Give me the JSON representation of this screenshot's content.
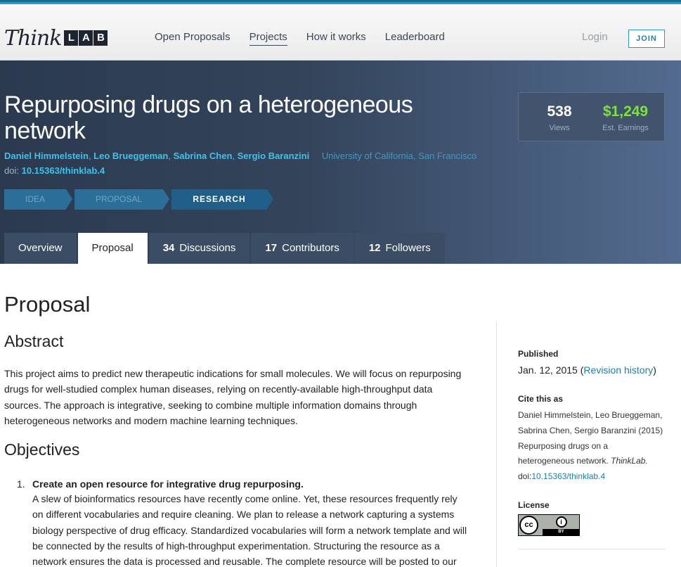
{
  "header": {
    "logo_text": "Think",
    "logo_box": [
      "L",
      "A",
      "B"
    ],
    "nav": [
      {
        "label": "Open Proposals",
        "active": false
      },
      {
        "label": "Projects",
        "active": true
      },
      {
        "label": "How it works",
        "active": false
      },
      {
        "label": "Leaderboard",
        "active": false
      }
    ],
    "login_label": "Login",
    "join_label": "JOIN"
  },
  "project": {
    "title": "Repurposing drugs on a heterogeneous network",
    "authors": [
      "Daniel Himmelstein",
      "Leo Brueggeman",
      "Sabrina Chen",
      "Sergio Baranzini"
    ],
    "affiliation": "University of California, San Francisco",
    "doi_label": "doi:",
    "doi": "10.15363/thinklab.4",
    "stages": [
      "IDEA",
      "PROPOSAL",
      "RESEARCH"
    ],
    "current_stage": "RESEARCH",
    "stats": {
      "views": "538",
      "views_label": "Views",
      "earnings": "$1,249",
      "earnings_label": "Est. Earnings"
    },
    "tabs": [
      {
        "count": "",
        "label": "Overview",
        "active": false
      },
      {
        "count": "",
        "label": "Proposal",
        "active": true
      },
      {
        "count": "34",
        "label": "Discussions",
        "active": false
      },
      {
        "count": "17",
        "label": "Contributors",
        "active": false
      },
      {
        "count": "12",
        "label": "Followers",
        "active": false
      }
    ]
  },
  "content": {
    "heading": "Proposal",
    "abstract_heading": "Abstract",
    "abstract_lines": [
      "This project aims to predict new therapeutic indications for small molecules. We will focus on repurposing",
      "drugs for well-studied complex human diseases, relying on recently-available high-throughput data",
      "sources. The approach is integrative, seeking to combine multiple information domains through",
      "heterogeneous networks and modern machine learning techniques."
    ],
    "objectives_heading": "Objectives",
    "objective_1": {
      "number": "1.",
      "title": "Create an open resource for integrative drug repurposing.",
      "lines": [
        "A slew of bioinformatics resources have recently come online. Yet, these resources frequently rely",
        "on different vocabularies and require cleaning. We plan to release a network capturing a systems",
        "biology perspective of drug efficacy. Standardized vocabularies will form a network template and will",
        "be connected by the results of high-throughput experimentation. Structuring the resource as a",
        "network ensures the data is processed and reusable. The complete resource will be posted to our"
      ]
    }
  },
  "sidebar": {
    "published_label": "Published",
    "published_date": "Jan. 12, 2015",
    "revision_open": "(",
    "revision_link": "Revision history",
    "revision_close": ")",
    "cite_label": "Cite this as",
    "cite_lines": [
      "Daniel Himmelstein, Leo Brueggeman,",
      "Sabrina Chen, Sergio Baranzini (2015)",
      "Repurposing drugs on a"
    ],
    "cite_line4_text": "heterogeneous network.",
    "cite_journal": "ThinkLab.",
    "cite_doi_label": "doi:",
    "cite_doi": "10.15363/thinklab.4",
    "license_label": "License",
    "license_badge": {
      "cc": "cc",
      "by_icon": "i",
      "by": "BY"
    }
  }
}
